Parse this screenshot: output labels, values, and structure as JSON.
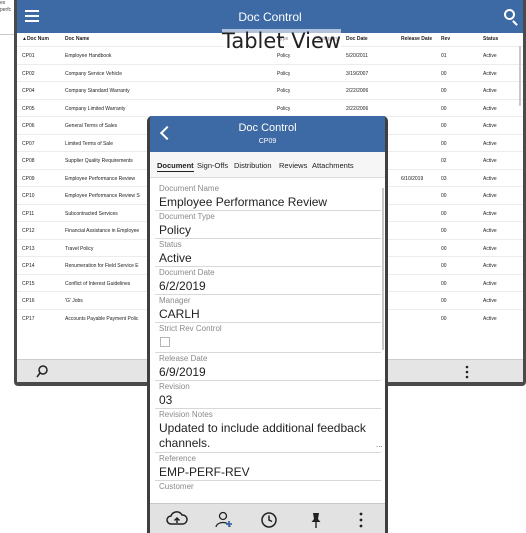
{
  "background": {
    "snippet_lines": [
      "es",
      "perfc"
    ]
  },
  "tablet": {
    "title": "Doc Control",
    "watermark": "Tablet View",
    "columns": [
      "▲Doc Num",
      "Doc Name",
      "Type",
      "Category",
      "Doc Date",
      "Release Date",
      "Rev",
      "Status"
    ],
    "rows": [
      [
        "CP01",
        "Employee Handbook",
        "Policy",
        "",
        "5/20/2011",
        "",
        "01",
        "Active"
      ],
      [
        "CP02",
        "Company Service Vehicle",
        "Policy",
        "",
        "3/19/2007",
        "",
        "00",
        "Active"
      ],
      [
        "CP04",
        "Company Standard Warranty",
        "Policy",
        "",
        "2/22/2006",
        "",
        "00",
        "Active"
      ],
      [
        "CP05",
        "Company Limited Warranty",
        "Policy",
        "",
        "2/22/2006",
        "",
        "00",
        "Active"
      ],
      [
        "CP06",
        "General Terms of Sales",
        "",
        "",
        "",
        "",
        "00",
        "Active"
      ],
      [
        "CP07",
        "Limited Terms of Sale",
        "",
        "",
        "",
        "",
        "00",
        "Active"
      ],
      [
        "CP08",
        "Supplier Quality Requirements",
        "",
        "",
        "",
        "",
        "02",
        "Active"
      ],
      [
        "CP09",
        "Employee Performance Review",
        "",
        "",
        "",
        "6/10/2019",
        "03",
        "Active"
      ],
      [
        "CP10",
        "Employee Performance Review S",
        "",
        "",
        "",
        "",
        "00",
        "Active"
      ],
      [
        "CP11",
        "Subcontracted Services",
        "",
        "",
        "",
        "",
        "00",
        "Active"
      ],
      [
        "CP12",
        "Financial Assistance in Employee",
        "",
        "",
        "",
        "",
        "00",
        "Active"
      ],
      [
        "CP13",
        "Travel Policy",
        "",
        "",
        "",
        "",
        "00",
        "Active"
      ],
      [
        "CP14",
        "Renumeration for Field Service E",
        "",
        "",
        "",
        "",
        "00",
        "Active"
      ],
      [
        "CP15",
        "Conflict of Interest Guidelines",
        "",
        "",
        "",
        "",
        "00",
        "Active"
      ],
      [
        "CP16",
        "'G' Jobs",
        "",
        "",
        "",
        "",
        "00",
        "Active"
      ],
      [
        "CP17",
        "Accounts Payable Payment Polic",
        "",
        "",
        "",
        "",
        "00",
        "Active"
      ]
    ]
  },
  "phone": {
    "title": "Doc Control",
    "subtitle": "CP09",
    "tabs": [
      "Document",
      "Sign-Offs",
      "Distribution",
      "Reviews",
      "Attachments"
    ],
    "fields": {
      "doc_name_label": "Document Name",
      "doc_name": "Employee Performance Review",
      "doc_type_label": "Document Type",
      "doc_type": "Policy",
      "status_label": "Status",
      "status": "Active",
      "doc_date_label": "Document Date",
      "doc_date": "6/2/2019",
      "manager_label": "Manager",
      "manager": "CARLH",
      "strict_rev_label": "Strict Rev Control",
      "release_date_label": "Release Date",
      "release_date": "6/9/2019",
      "revision_label": "Revision",
      "revision": "03",
      "revision_notes_label": "Revision Notes",
      "revision_notes_1": "Updated to include additional feedback",
      "revision_notes_2": "channels.",
      "revision_notes_more": "...",
      "reference_label": "Reference",
      "reference": "EMP-PERF-REV",
      "customer_label": "Customer"
    },
    "icons": [
      "cloud-upload-icon",
      "add-user-icon",
      "history-clock-icon",
      "pin-icon",
      "more-vertical-icon"
    ]
  }
}
